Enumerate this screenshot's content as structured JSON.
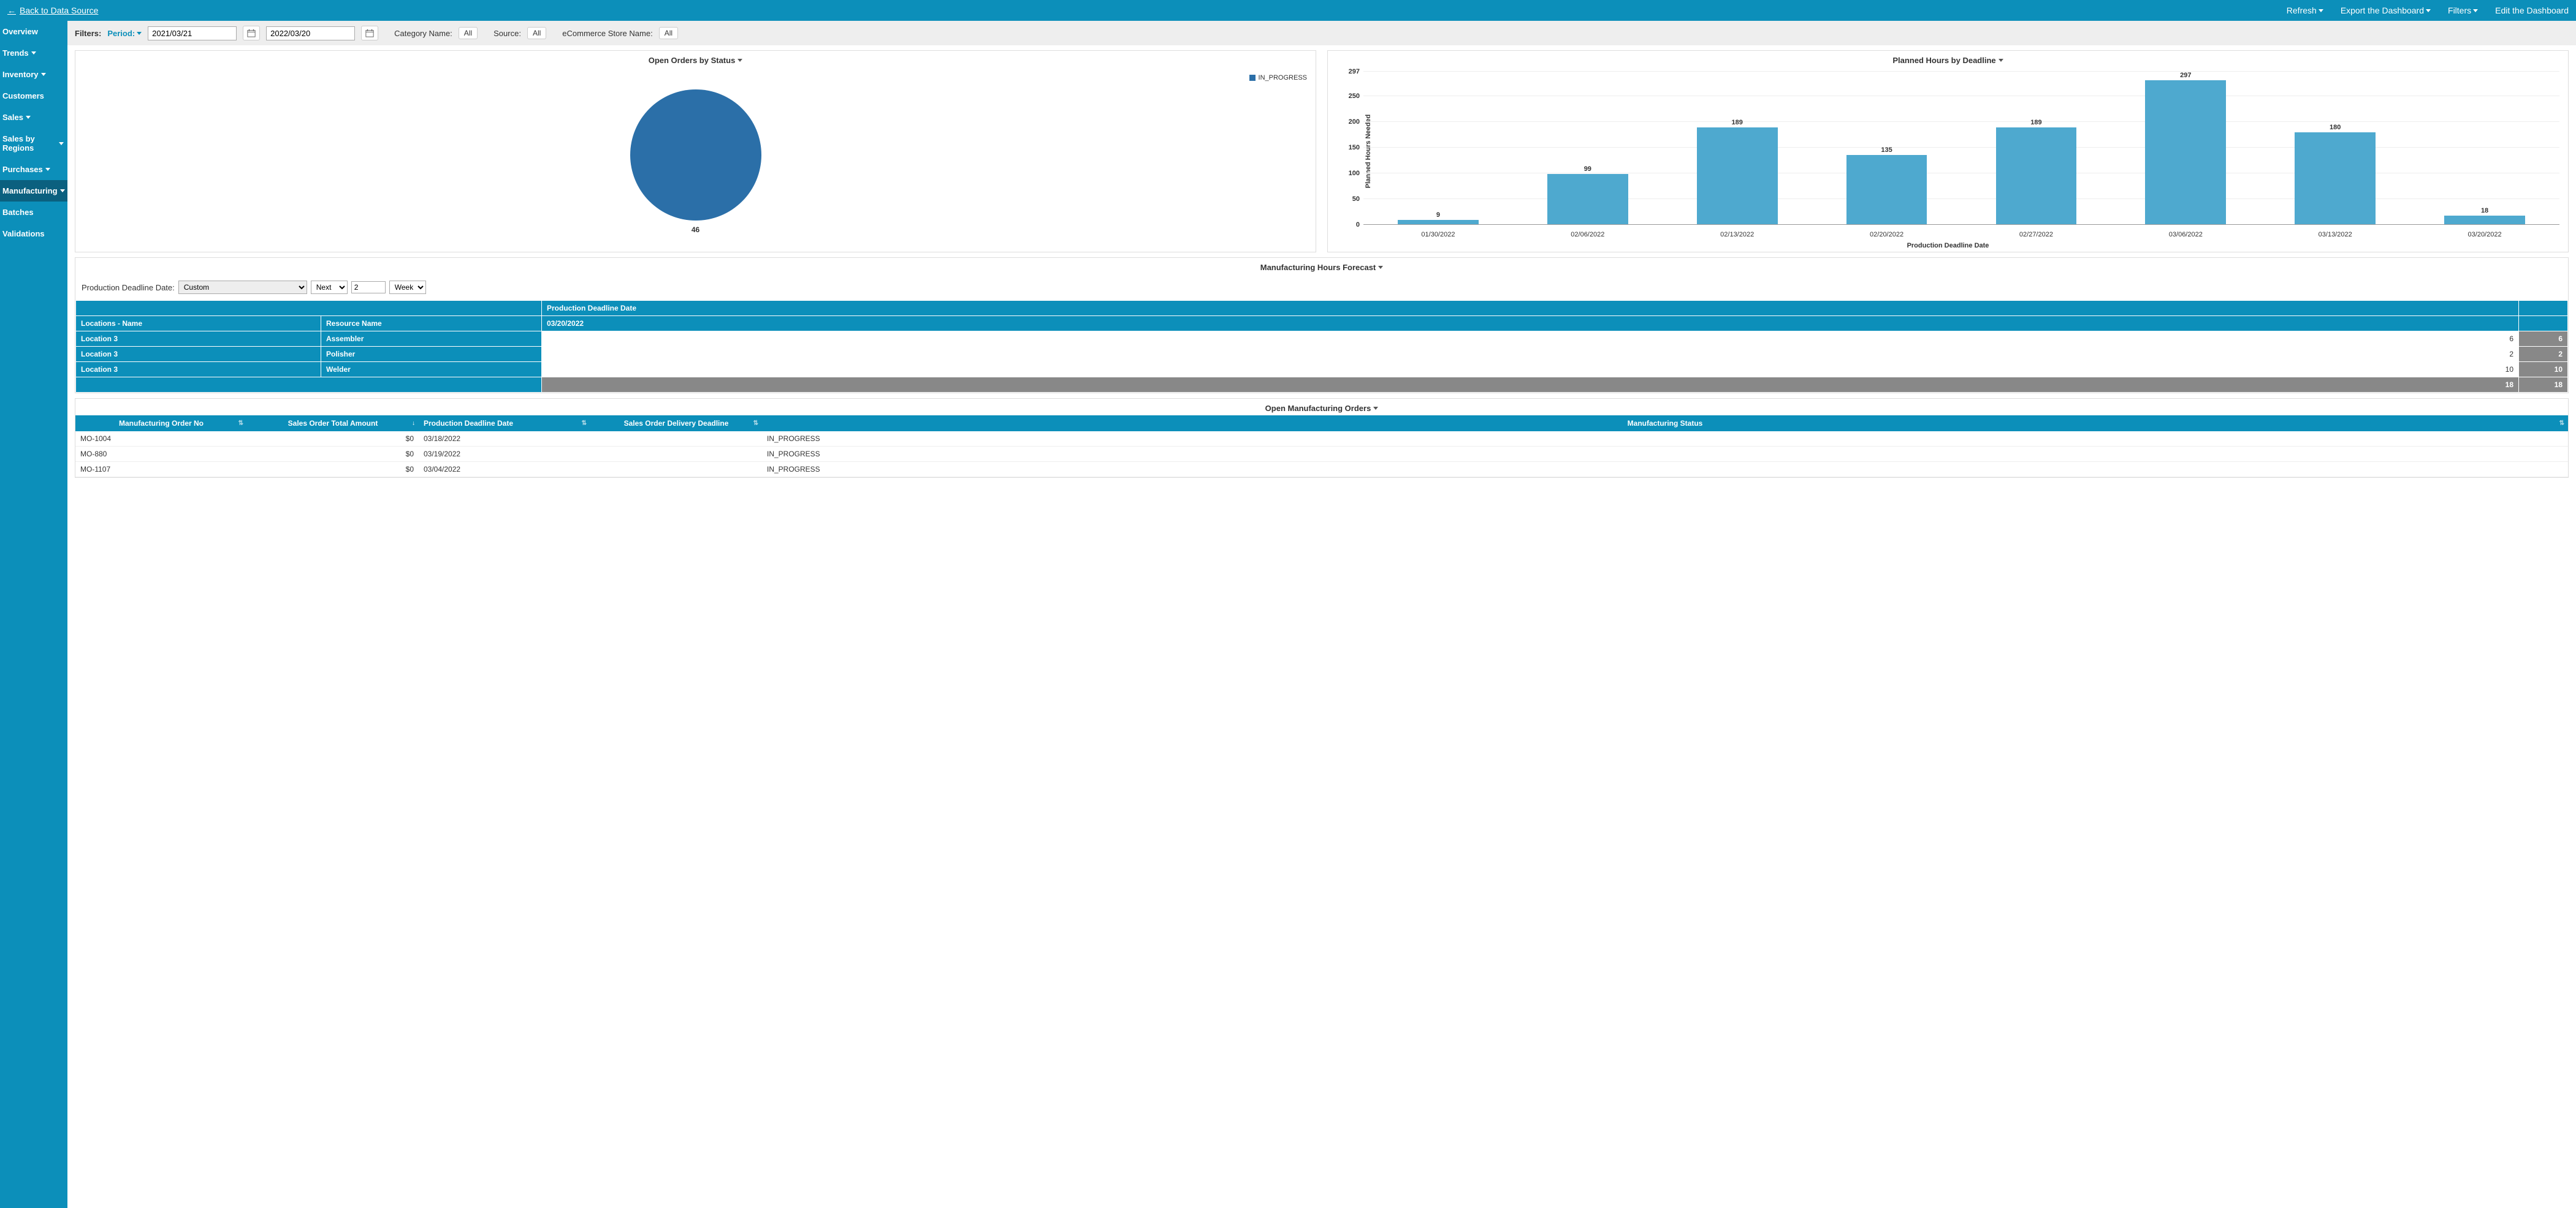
{
  "topbar": {
    "back": "Back to Data Source",
    "refresh": "Refresh",
    "export": "Export the Dashboard",
    "filters": "Filters",
    "edit": "Edit the Dashboard"
  },
  "sidebar": {
    "items": [
      {
        "label": "Overview",
        "caret": false
      },
      {
        "label": "Trends",
        "caret": true
      },
      {
        "label": "Inventory",
        "caret": true
      },
      {
        "label": "Customers",
        "caret": false
      },
      {
        "label": "Sales",
        "caret": true
      },
      {
        "label": "Sales by Regions",
        "caret": true
      },
      {
        "label": "Purchases",
        "caret": true
      },
      {
        "label": "Manufacturing",
        "caret": true,
        "active": true
      },
      {
        "label": "Batches",
        "caret": false
      },
      {
        "label": "Validations",
        "caret": false
      }
    ]
  },
  "filterbar": {
    "label": "Filters:",
    "period": "Period:",
    "date_from": "2021/03/21",
    "date_to": "2022/03/20",
    "category_label": "Category Name:",
    "category_val": "All",
    "source_label": "Source:",
    "source_val": "All",
    "store_label": "eCommerce Store Name:",
    "store_val": "All"
  },
  "pie": {
    "title": "Open Orders by Status",
    "legend": "IN_PROGRESS",
    "value": "46"
  },
  "barChart": {
    "title": "Planned Hours by Deadline",
    "ylabel": "Planned Hours Needed",
    "xlabel": "Production Deadline Date",
    "ymax_label": "297"
  },
  "chart_data": {
    "type": "bar",
    "title": "Planned Hours by Deadline",
    "xlabel": "Production Deadline Date",
    "ylabel": "Planned Hours Needed",
    "ylim": [
      0,
      297
    ],
    "yticks": [
      0,
      50,
      100,
      150,
      200,
      250,
      297
    ],
    "categories": [
      "01/30/2022",
      "02/06/2022",
      "02/13/2022",
      "02/20/2022",
      "02/27/2022",
      "03/06/2022",
      "03/13/2022",
      "03/20/2022"
    ],
    "values": [
      9,
      99,
      189,
      135,
      189,
      297,
      180,
      18
    ]
  },
  "forecast": {
    "title": "Manufacturing Hours Forecast",
    "pdd_label": "Production Deadline Date:",
    "custom": "Custom",
    "next": "Next",
    "num": "2",
    "unit": "Weeks",
    "col_pdd": "Production Deadline Date",
    "col_loc": "Locations - Name",
    "col_res": "Resource Name",
    "col_date": "03/20/2022",
    "rows": [
      {
        "loc": "Location 3",
        "res": "Assembler",
        "v": "6",
        "t": "6"
      },
      {
        "loc": "Location 3",
        "res": "Polisher",
        "v": "2",
        "t": "2"
      },
      {
        "loc": "Location 3",
        "res": "Welder",
        "v": "10",
        "t": "10"
      }
    ],
    "total_v": "18",
    "total_t": "18"
  },
  "orders": {
    "title": "Open Manufacturing Orders",
    "cols": {
      "mo": "Manufacturing Order No",
      "amount": "Sales Order Total Amount",
      "pdd": "Production Deadline Date",
      "delivery": "Sales Order Delivery Deadline",
      "status": "Manufacturing Status"
    },
    "rows": [
      {
        "mo": "MO-1004",
        "amount": "$0",
        "pdd": "03/18/2022",
        "delivery": "",
        "status": "IN_PROGRESS"
      },
      {
        "mo": "MO-880",
        "amount": "$0",
        "pdd": "03/19/2022",
        "delivery": "",
        "status": "IN_PROGRESS"
      },
      {
        "mo": "MO-1107",
        "amount": "$0",
        "pdd": "03/04/2022",
        "delivery": "",
        "status": "IN_PROGRESS"
      }
    ]
  }
}
